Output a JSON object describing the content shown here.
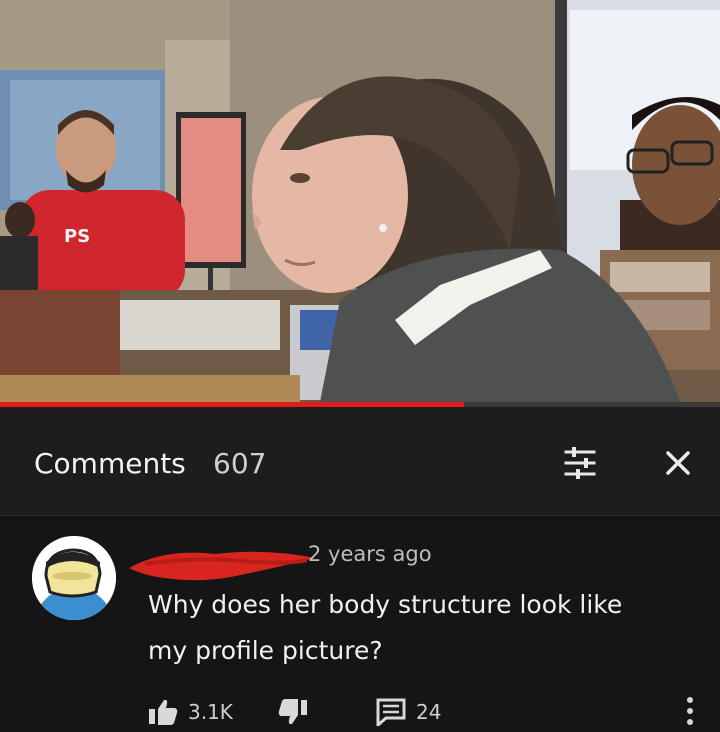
{
  "video": {
    "progress_fraction": 0.645,
    "progress_color": "#e21b1b",
    "shirt_text": "PS"
  },
  "comments": {
    "title": "Comments",
    "count": "607",
    "filter_icon": "sliders-icon",
    "close_icon": "close-icon"
  },
  "comment": {
    "avatar_icon": "cartoon-avatar",
    "author_redacted": true,
    "timestamp": "2 years ago",
    "line1": "Why does her body structure look like",
    "line2": "my profile picture?",
    "likes": "3.1K",
    "replies": "24"
  }
}
